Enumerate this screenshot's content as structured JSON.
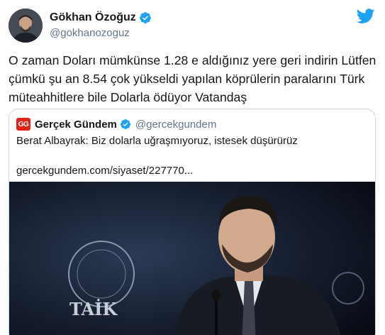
{
  "tweet": {
    "author_name": "Gökhan Özoğuz",
    "author_handle": "@gokhanozoguz",
    "text": "O zaman Doları mümkünse 1.28 e aldığınız yere geri indirin Lütfen çümkü şu an 8.54 çok yükseldi yapılan köprülerin paralarını Türk müteahhitlere bile Dolarla ödüyor Vatandaş"
  },
  "quoted": {
    "logo_text": "GG",
    "author_name": "Gerçek Gündem",
    "author_handle": "@gercekgundem",
    "text": "Berat Albayrak: Biz dolarla uğraşmıyoruz, istesek düşürürüz",
    "link": "gercekgundem.com/siyaset/227770...",
    "image_sign_text": "TAİK"
  },
  "colors": {
    "twitter_blue": "#1da1f2",
    "text": "#14171a",
    "secondary": "#657786",
    "border": "#ccd6dd"
  },
  "icons": {
    "verified": "verified-badge-icon",
    "brand": "twitter-bird-icon"
  }
}
